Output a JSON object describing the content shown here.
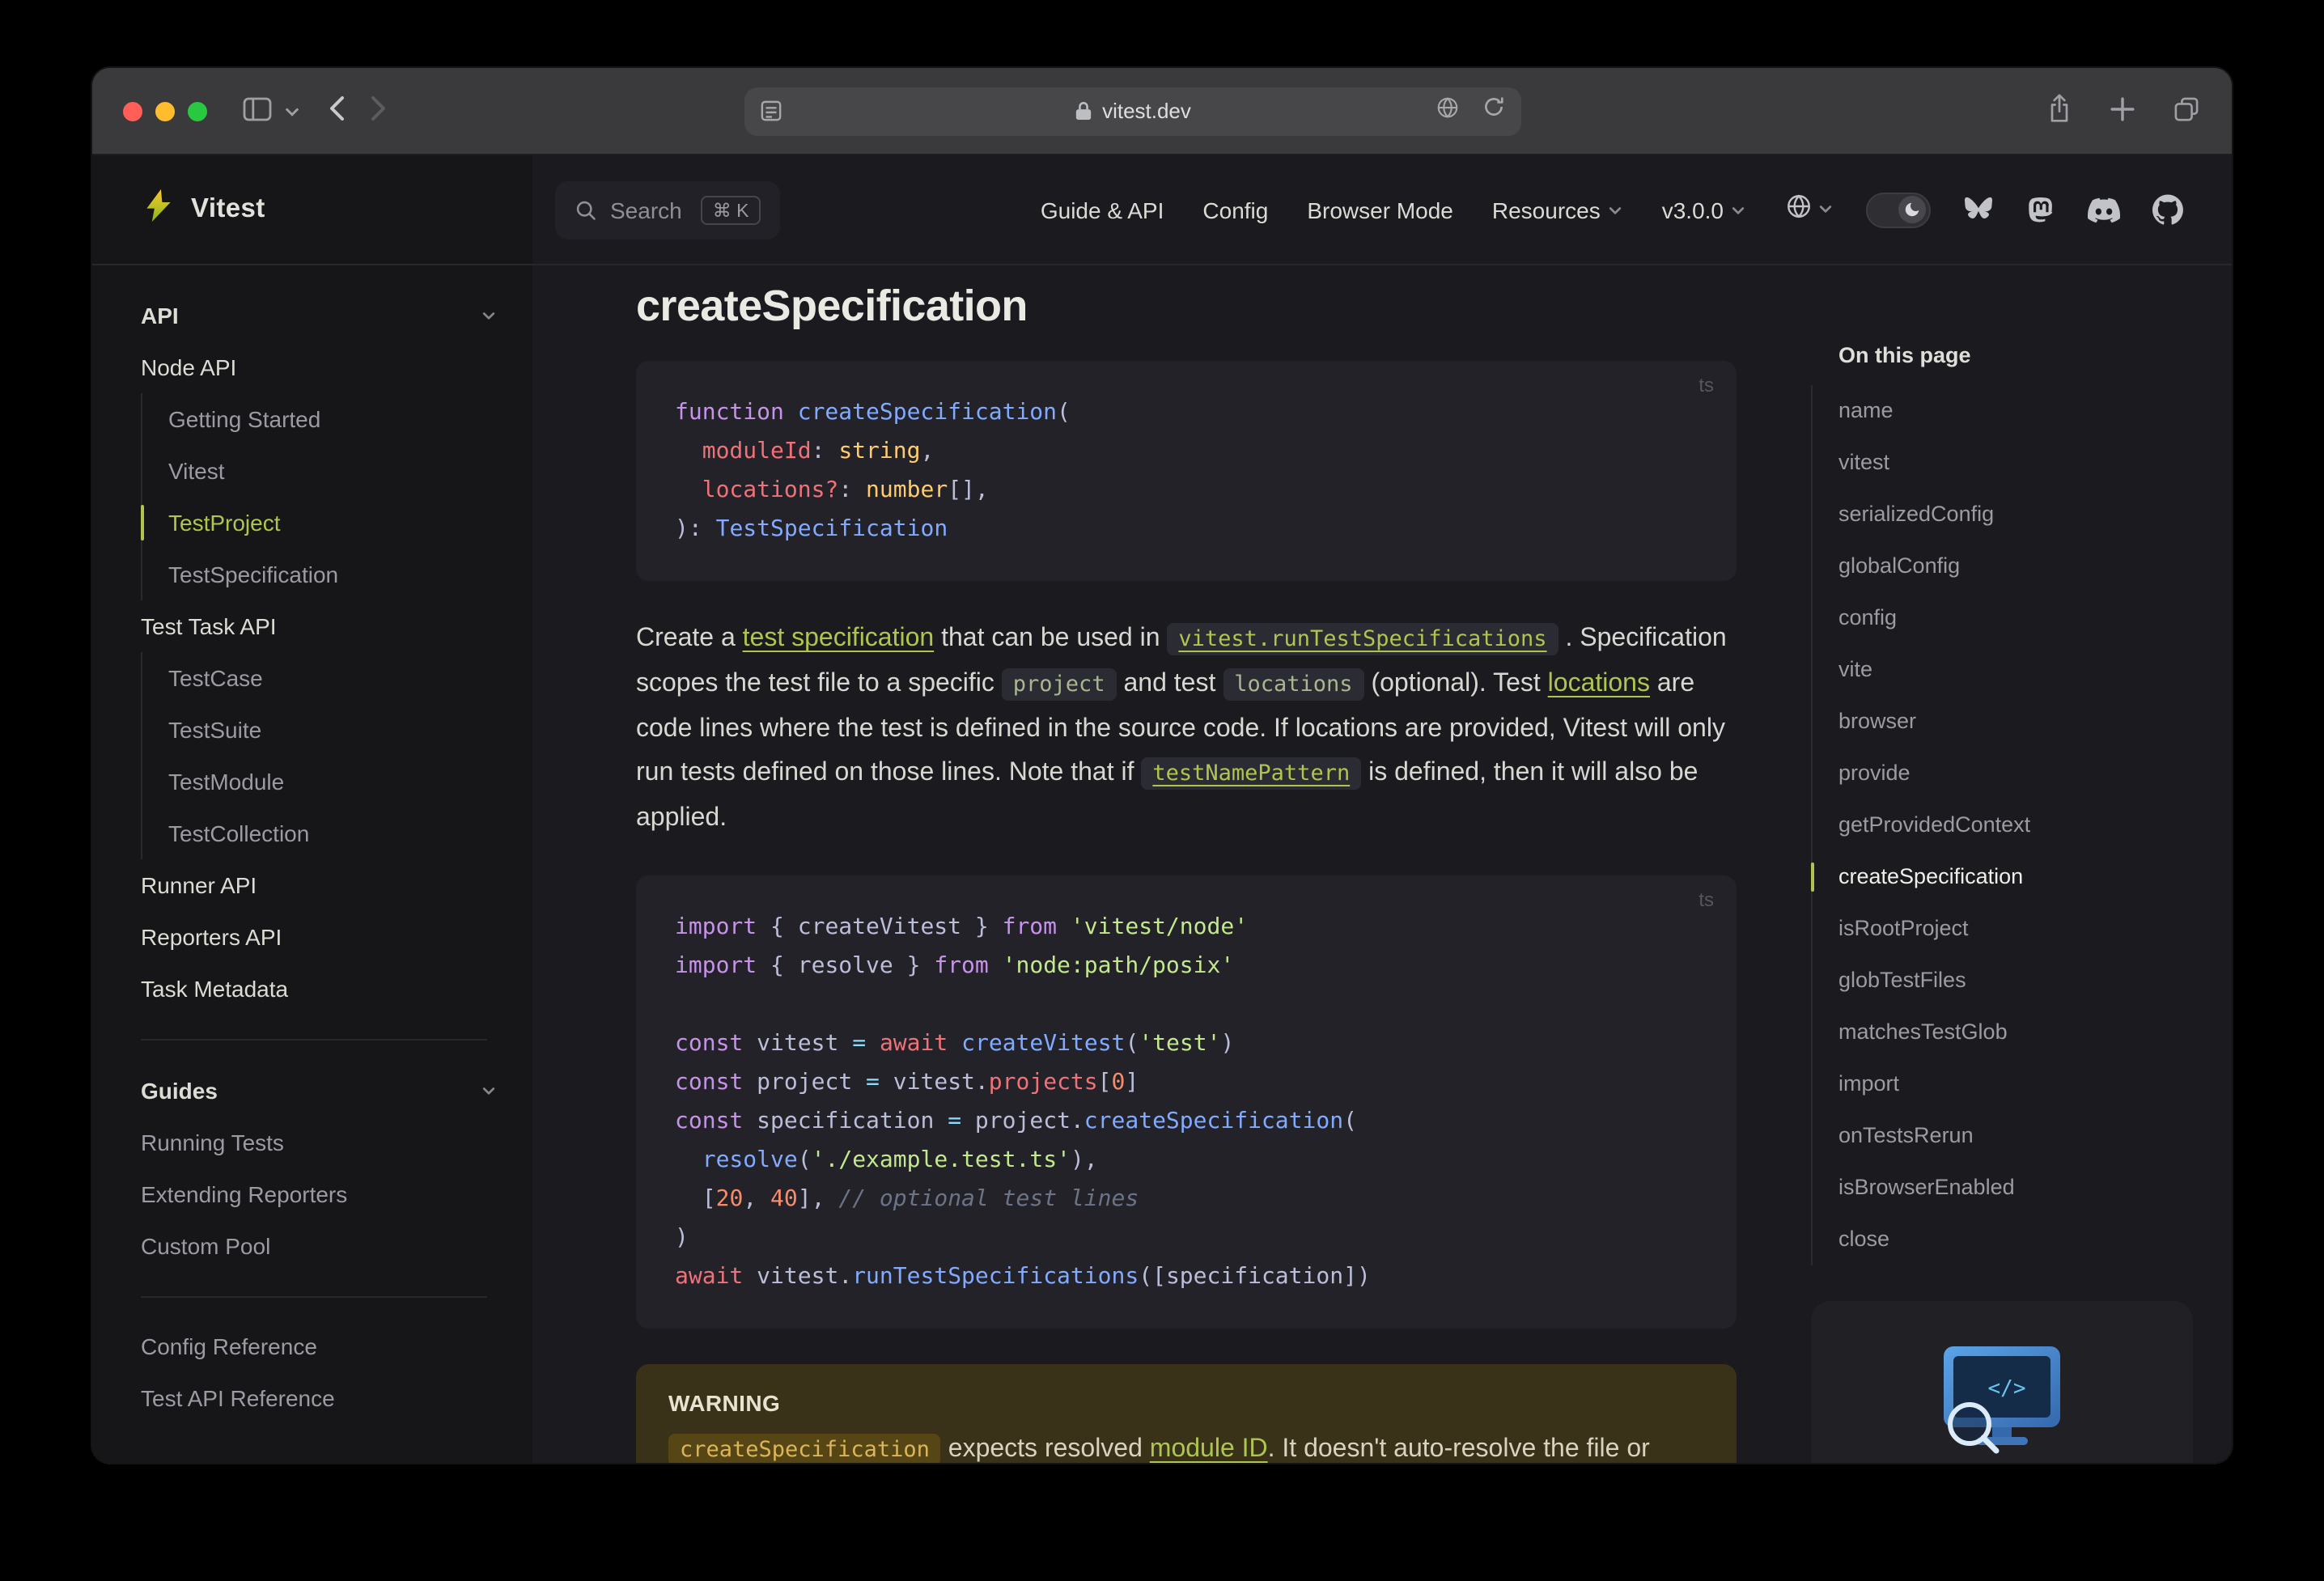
{
  "browser": {
    "url": "vitest.dev",
    "traffic_lights": [
      "close",
      "minimize",
      "zoom"
    ]
  },
  "brand": {
    "name": "Vitest"
  },
  "colors": {
    "brand": "#aec64f",
    "traffic": [
      "#ff5f57",
      "#febc2e",
      "#28c840"
    ],
    "warning_bg": "#3a3119"
  },
  "icons": {
    "toolbar": [
      "sidebar-toggle-icon",
      "chevron-down-icon",
      "back-icon",
      "forward-icon",
      "page-settings-icon",
      "lock-icon",
      "translate-icon",
      "reload-icon",
      "share-icon",
      "new-tab-icon",
      "tab-overview-icon"
    ],
    "nav": [
      "search-icon",
      "language-icon",
      "moon-icon",
      "bluesky-icon",
      "mastodon-icon",
      "discord-icon",
      "github-icon"
    ]
  },
  "topnav": {
    "search": {
      "label": "Search",
      "shortcut": "⌘ K"
    },
    "links": [
      "Guide & API",
      "Config",
      "Browser Mode"
    ],
    "dropdowns": [
      "Resources",
      "v3.0.0"
    ]
  },
  "sidebar": {
    "sections": [
      {
        "header": "API",
        "collapsible": true,
        "rows": [
          {
            "label": "Node API",
            "kind": "section"
          },
          {
            "label": "Getting Started",
            "kind": "sub"
          },
          {
            "label": "Vitest",
            "kind": "sub"
          },
          {
            "label": "TestProject",
            "kind": "sub",
            "active": true
          },
          {
            "label": "TestSpecification",
            "kind": "sub"
          },
          {
            "label": "Test Task API",
            "kind": "section"
          },
          {
            "label": "TestCase",
            "kind": "sub"
          },
          {
            "label": "TestSuite",
            "kind": "sub"
          },
          {
            "label": "TestModule",
            "kind": "sub"
          },
          {
            "label": "TestCollection",
            "kind": "sub"
          },
          {
            "label": "Runner API",
            "kind": "section"
          },
          {
            "label": "Reporters API",
            "kind": "section"
          },
          {
            "label": "Task Metadata",
            "kind": "section"
          }
        ]
      },
      {
        "header": "Guides",
        "collapsible": true,
        "rows": [
          {
            "label": "Running Tests",
            "kind": "link"
          },
          {
            "label": "Extending Reporters",
            "kind": "link"
          },
          {
            "label": "Custom Pool",
            "kind": "link"
          }
        ]
      },
      {
        "header": null,
        "rows": [
          {
            "label": "Config Reference",
            "kind": "link"
          },
          {
            "label": "Test API Reference",
            "kind": "link"
          }
        ]
      }
    ]
  },
  "doc": {
    "title": "createSpecification",
    "code_blocks": [
      {
        "lang": "ts",
        "lines": [
          [
            [
              "k",
              "function "
            ],
            [
              "f",
              "createSpecification"
            ],
            [
              "d",
              "("
            ]
          ],
          [
            [
              "d",
              "  "
            ],
            [
              "v",
              "moduleId"
            ],
            [
              "d",
              ": "
            ],
            [
              "t",
              "string"
            ],
            [
              "d",
              ","
            ]
          ],
          [
            [
              "d",
              "  "
            ],
            [
              "v",
              "locations?"
            ],
            [
              "d",
              ": "
            ],
            [
              "t",
              "number"
            ],
            [
              "d",
              "[],"
            ]
          ],
          [
            [
              "d",
              "): "
            ],
            [
              "f",
              "TestSpecification"
            ]
          ]
        ]
      },
      {
        "lang": "ts",
        "lines": [
          [
            [
              "k",
              "import"
            ],
            [
              "d",
              " { createVitest } "
            ],
            [
              "k",
              "from"
            ],
            [
              "d",
              " "
            ],
            [
              "s",
              "'vitest/node'"
            ]
          ],
          [
            [
              "k",
              "import"
            ],
            [
              "d",
              " { resolve } "
            ],
            [
              "k",
              "from"
            ],
            [
              "d",
              " "
            ],
            [
              "s",
              "'node:path/posix'"
            ]
          ],
          [],
          [
            [
              "k",
              "const"
            ],
            [
              "d",
              " vitest "
            ],
            [
              "o",
              "="
            ],
            [
              "d",
              " "
            ],
            [
              "aw",
              "await"
            ],
            [
              "d",
              " "
            ],
            [
              "f",
              "createVitest"
            ],
            [
              "d",
              "("
            ],
            [
              "s",
              "'test'"
            ],
            [
              "d",
              ")"
            ]
          ],
          [
            [
              "k",
              "const"
            ],
            [
              "d",
              " project "
            ],
            [
              "o",
              "="
            ],
            [
              "d",
              " vitest."
            ],
            [
              "v",
              "projects"
            ],
            [
              "d",
              "["
            ],
            [
              "n",
              "0"
            ],
            [
              "d",
              "]"
            ]
          ],
          [
            [
              "k",
              "const"
            ],
            [
              "d",
              " specification "
            ],
            [
              "o",
              "="
            ],
            [
              "d",
              " project."
            ],
            [
              "f",
              "createSpecification"
            ],
            [
              "d",
              "("
            ]
          ],
          [
            [
              "d",
              "  "
            ],
            [
              "f",
              "resolve"
            ],
            [
              "d",
              "("
            ],
            [
              "s",
              "'./example.test.ts'"
            ],
            [
              "d",
              "),"
            ]
          ],
          [
            [
              "d",
              "  ["
            ],
            [
              "n",
              "20"
            ],
            [
              "d",
              ", "
            ],
            [
              "n",
              "40"
            ],
            [
              "d",
              "], "
            ],
            [
              "c",
              "// optional test lines"
            ]
          ],
          [
            [
              "d",
              ")"
            ]
          ],
          [
            [
              "aw",
              "await"
            ],
            [
              "d",
              " vitest."
            ],
            [
              "f",
              "runTestSpecifications"
            ],
            [
              "d",
              "(["
            ],
            [
              "d",
              "specification"
            ],
            [
              "d",
              "])"
            ]
          ]
        ]
      }
    ],
    "paragraph": [
      {
        "t": "Create a "
      },
      {
        "t": "test specification",
        "s": "link"
      },
      {
        "t": " that can be used in "
      },
      {
        "t": "vitest.runTestSpecifications",
        "s": "codelink"
      },
      {
        "t": " . Specification scopes the test file to a specific "
      },
      {
        "t": "project",
        "s": "code"
      },
      {
        "t": " and test "
      },
      {
        "t": "locations",
        "s": "code"
      },
      {
        "t": " (optional). Test "
      },
      {
        "t": "locations",
        "s": "link"
      },
      {
        "t": " are code lines where the test is defined in the source code. If locations are provided, Vitest will only run tests defined on those lines. Note that if "
      },
      {
        "t": "testNamePattern",
        "s": "codelink"
      },
      {
        "t": " is defined, then it will also be applied."
      }
    ],
    "warning": {
      "label": "WARNING",
      "runs": [
        {
          "t": "createSpecification",
          "s": "codewarn"
        },
        {
          "t": " expects resolved "
        },
        {
          "t": "module ID",
          "s": "link"
        },
        {
          "t": ". It doesn't auto-resolve the file or check that it exists on the file system."
        }
      ]
    }
  },
  "aside": {
    "title": "On this page",
    "items": [
      "name",
      "vitest",
      "serializedConfig",
      "globalConfig",
      "config",
      "vite",
      "browser",
      "provide",
      "getProvidedContext",
      "createSpecification",
      "isRootProject",
      "globTestFiles",
      "matchesTestGlob",
      "import",
      "onTestsRerun",
      "isBrowserEnabled",
      "close"
    ],
    "active": "createSpecification"
  }
}
